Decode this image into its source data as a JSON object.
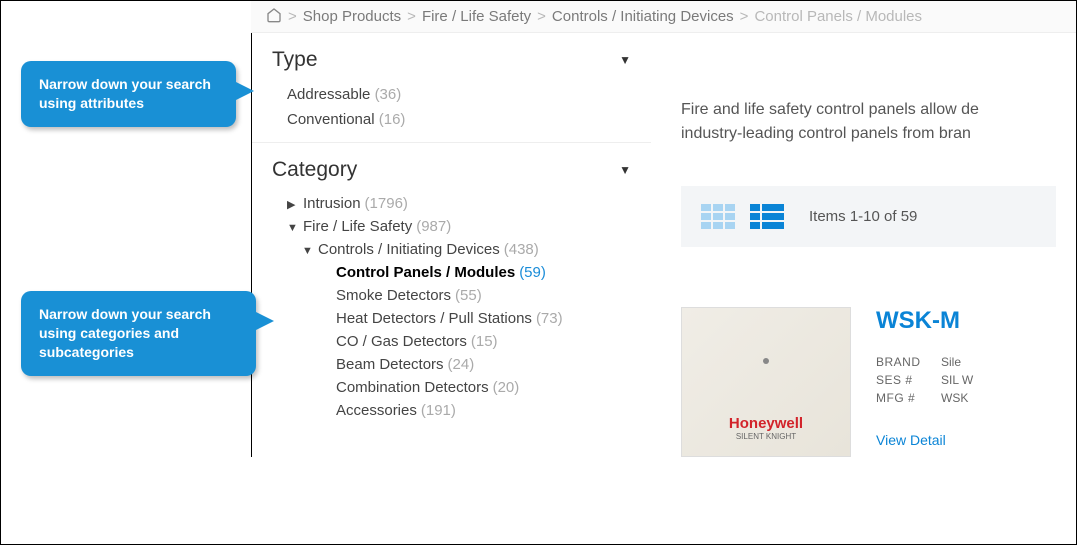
{
  "breadcrumb": {
    "home_icon": "home-icon",
    "items": [
      "Shop Products",
      "Fire / Life Safety",
      "Controls / Initiating Devices"
    ],
    "current": "Control Panels / Modules"
  },
  "callouts": {
    "attributes": "Narrow down your search using attributes",
    "categories": "Narrow down your search using categories and subcategories"
  },
  "facets": {
    "type": {
      "title": "Type",
      "items": [
        {
          "label": "Addressable",
          "count": "(36)"
        },
        {
          "label": "Conventional",
          "count": "(16)"
        }
      ]
    },
    "category": {
      "title": "Category",
      "tree": [
        {
          "label": "Intrusion",
          "count": "(1796)",
          "arrow": "▶",
          "indent": 1,
          "active": false
        },
        {
          "label": "Fire / Life Safety",
          "count": "(987)",
          "arrow": "▼",
          "indent": 1,
          "active": false
        },
        {
          "label": "Controls / Initiating Devices",
          "count": "(438)",
          "arrow": "▼",
          "indent": 2,
          "active": false
        },
        {
          "label": "Control Panels / Modules",
          "count": "(59)",
          "arrow": "",
          "indent": 3,
          "active": true
        },
        {
          "label": "Smoke Detectors",
          "count": "(55)",
          "arrow": "",
          "indent": 3,
          "active": false
        },
        {
          "label": "Heat Detectors / Pull Stations",
          "count": "(73)",
          "arrow": "",
          "indent": 3,
          "active": false
        },
        {
          "label": "CO / Gas Detectors",
          "count": "(15)",
          "arrow": "",
          "indent": 3,
          "active": false
        },
        {
          "label": "Beam Detectors",
          "count": "(24)",
          "arrow": "",
          "indent": 3,
          "active": false
        },
        {
          "label": "Combination Detectors",
          "count": "(20)",
          "arrow": "",
          "indent": 3,
          "active": false
        },
        {
          "label": "Accessories",
          "count": "(191)",
          "arrow": "",
          "indent": 3,
          "active": false
        }
      ]
    }
  },
  "main": {
    "description": "Fire and life safety control panels allow de… industry-leading control panels from bran…",
    "desc_line1": "Fire and life safety control panels allow de",
    "desc_line2": "industry-leading control panels from bran",
    "items_count": "Items 1-10 of 59",
    "product": {
      "title": "WSK-M",
      "brand_logo": "Honeywell",
      "specs": [
        {
          "key": "BRAND",
          "val": "Sile"
        },
        {
          "key": "SES #",
          "val": "SIL W"
        },
        {
          "key": "MFG #",
          "val": "WSK"
        }
      ],
      "view_detail": "View Detail"
    }
  }
}
